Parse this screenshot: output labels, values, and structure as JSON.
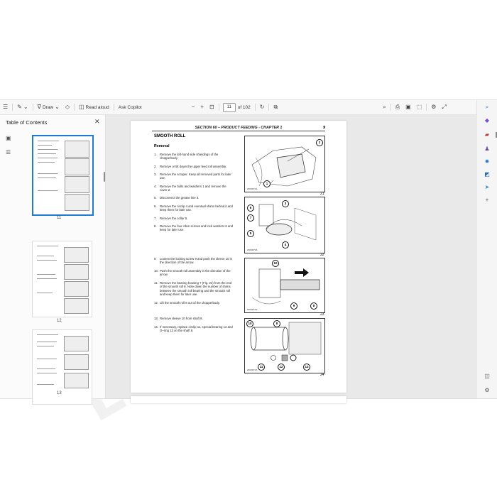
{
  "toolbar": {
    "draw_label": "Draw",
    "read_aloud_label": "Read aloud",
    "copilot_label": "Ask Copilot",
    "zoom_out": "−",
    "zoom_in": "+",
    "page_current": "11",
    "page_total": "of 102"
  },
  "toc": {
    "title": "Table of Contents",
    "thumbnails": [
      {
        "number": "11",
        "active": true
      },
      {
        "number": "12",
        "active": false
      },
      {
        "number": "13",
        "active": false
      }
    ]
  },
  "page": {
    "header": "SECTION 60 – PRODUCT FEEDING - CHAPTER 1",
    "page_number": "9",
    "title": "SMOOTH ROLL",
    "subtitle": "Removal",
    "steps": [
      {
        "n": "1.",
        "text": "Remove the left-hand side shieldings of the chopperbody."
      },
      {
        "n": "2.",
        "text": "Remove or tilt down the upper feed roll assembly."
      },
      {
        "n": "3.",
        "text": "Remove the scraper. Keep all removed parts for later use."
      },
      {
        "n": "4.",
        "text": "Remove the bolts and washers 1 and remove the cover 2."
      },
      {
        "n": "5.",
        "text": "Disconnect the grease line 3."
      },
      {
        "n": "6.",
        "text": "Remove the circlip 4 and eventual shims behind it and keep them for later use."
      },
      {
        "n": "7.",
        "text": "Remove the collar 5."
      },
      {
        "n": "8.",
        "text": "Remove the four Allen screws and lock washers 6 and keep for later use."
      },
      {
        "n": "9.",
        "text": "Loosen the locking screw 9 and push the sleeve 10 in the direction of the arrow."
      },
      {
        "n": "10.",
        "text": "Push the smooth roll assembly in the direction of the arrow."
      },
      {
        "n": "11.",
        "text": "Remove the bearing housing 7 (Fig. 22) from the end of the smooth roll 8. Note down the number of shims between the smooth roll bearing and the smooth roll and keep them for later use."
      },
      {
        "n": "12.",
        "text": "Lift the smooth roll 8 out of the chopperbody."
      },
      {
        "n": "13.",
        "text": "Remove sleeve 10 from shaft 8."
      },
      {
        "n": "14.",
        "text": "If necessary, replace circlip 11, special bearing 12 and O–ring 13 on the shaft 8."
      }
    ],
    "figures": [
      {
        "number": "21",
        "id": "ZDF0674A",
        "callouts": [
          "2",
          "1"
        ]
      },
      {
        "number": "22",
        "id": "ZDF0673A",
        "callouts": [
          "3",
          "6",
          "7",
          "5",
          "4"
        ]
      },
      {
        "number": "23",
        "id": "ZDF0672A",
        "callouts": [
          "10",
          "9",
          "8"
        ]
      },
      {
        "number": "24",
        "id": "ZDF0671A",
        "callouts": [
          "10",
          "8",
          "11",
          "12",
          "13"
        ]
      }
    ],
    "watermark": "EPCATALOG.COM"
  },
  "colors": {
    "accent": "#1e7ad6",
    "page_bg": "#e9e9e9"
  }
}
